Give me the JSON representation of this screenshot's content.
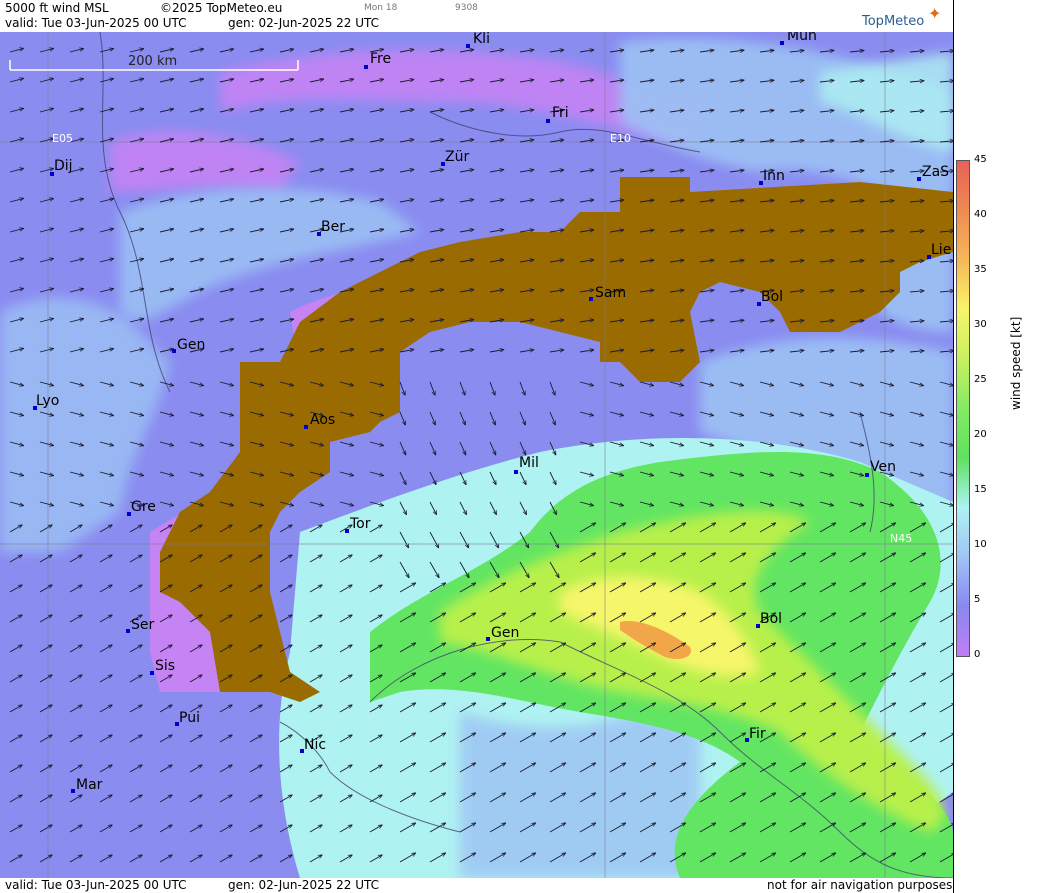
{
  "header": {
    "product": "5000 ft wind MSL",
    "copyright": "©2025 TopMeteo.eu",
    "model": "Mon 18",
    "code": "9308",
    "valid": "valid:  Tue  03-Jun-2025  00 UTC",
    "gen": "gen:  02-Jun-2025 22 UTC",
    "logo": "TopMeteo"
  },
  "footer": {
    "valid": "valid:  Tue  03-Jun-2025  00 UTC",
    "gen": "gen:  02-Jun-2025 22 UTC",
    "disclaimer": "not for air navigation purposes"
  },
  "map": {
    "scale_label": "200 km",
    "grid_labels": [
      "E05",
      "E10",
      "N45"
    ],
    "cities": [
      {
        "name": "Kli"
      },
      {
        "name": "Mun"
      },
      {
        "name": "Fre"
      },
      {
        "name": "Fri"
      },
      {
        "name": "Dij"
      },
      {
        "name": "Zür"
      },
      {
        "name": "Inn"
      },
      {
        "name": "ZaS"
      },
      {
        "name": "Ber"
      },
      {
        "name": "Lie"
      },
      {
        "name": "Sam"
      },
      {
        "name": "Bol"
      },
      {
        "name": "Gen"
      },
      {
        "name": "Lyo"
      },
      {
        "name": "Aos"
      },
      {
        "name": "Mil"
      },
      {
        "name": "Ven"
      },
      {
        "name": "Gre"
      },
      {
        "name": "Tor"
      },
      {
        "name": "Ser"
      },
      {
        "name": "Gen"
      },
      {
        "name": "Bol"
      },
      {
        "name": "Sis"
      },
      {
        "name": "Pui"
      },
      {
        "name": "Fir"
      },
      {
        "name": "Nic"
      },
      {
        "name": "Mar"
      }
    ],
    "colors": {
      "terrain": "#9a6b00",
      "low": "#c583f4",
      "mid": "#8a8cf0",
      "blue": "#9cc2f4",
      "cyan": "#aff2f2",
      "green": "#62e562",
      "yellowgreen": "#b8f04c",
      "yellow": "#f6f66a",
      "orange": "#f2a64a",
      "red": "#ef7066"
    }
  },
  "legend": {
    "title": "wind speed [kt]",
    "ticks": [
      "45",
      "40",
      "35",
      "30",
      "25",
      "20",
      "15",
      "10",
      "5",
      "0"
    ],
    "colors": [
      "#e8605a",
      "#f08a52",
      "#f6b858",
      "#f8f46a",
      "#c8f060",
      "#84ea64",
      "#5fe060",
      "#aef2f2",
      "#a0c4f6",
      "#8a88f0",
      "#c07ef4"
    ]
  }
}
